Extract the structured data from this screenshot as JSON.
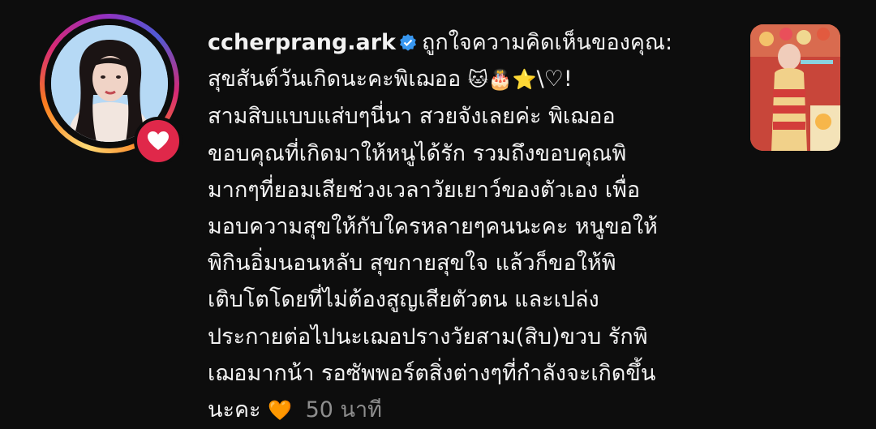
{
  "notification": {
    "username": "ccherprang.ark",
    "action_text": "ถูกใจความคิดเห็นของคุณ:",
    "comment_lines": [
      "สุขสันต์วันเกิดนะคะพิเฌออ",
      "สามสิบแบบแส่บๆนี่นา สวยจังเลยค่ะ พิเฌออ",
      "ขอบคุณที่เกิดมาให้หนูได้รัก รวมถึงขอบคุณพิ",
      "มากๆที่ยอมเสียช่วงเวลาวัยเยาว์ของตัวเอง เพื่อ",
      "มอบความสุขให้กับใครหลายๆคนนะคะ หนูขอให้",
      "พิกินอิ่มนอนหลับ สุขกายสุขใจ แล้วก็ขอให้พิ",
      "เติบโตโดยที่ไม่ต้องสูญเสียตัวตน และเปล่ง",
      "ประกายต่อไปนะเฌอปรางวัยสาม(สิบ)ขวบ รักพิ",
      "เฌอมากน้า รอซัพพอร์ตสิ่งต่างๆที่กำลังจะเกิดขึ้น",
      "นะคะ"
    ],
    "line1_emojis": "🐱🎂⭐",
    "line1_suffix": "\\♡!",
    "end_emoji": "🧡",
    "timestamp": "50 นาที"
  },
  "colors": {
    "background": "#0d0d0d",
    "text": "#f2f2f2",
    "muted": "#8e8e8e",
    "verified": "#3897f0",
    "like_badge": "#e0284a"
  },
  "icons": [
    "verified-badge-icon",
    "heart-icon"
  ]
}
